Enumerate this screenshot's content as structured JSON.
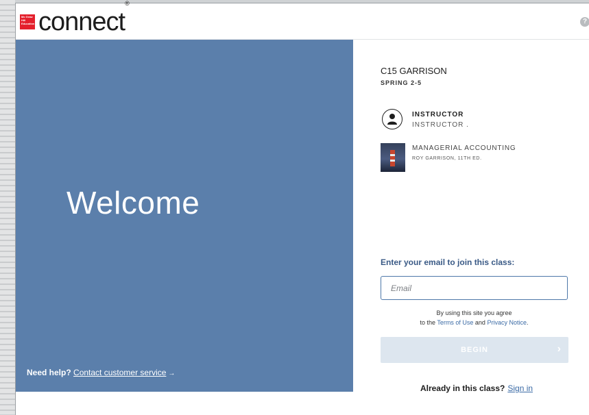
{
  "brand": {
    "publisher_logo_text": "Mc Graw Hill Education",
    "product_name": "connect",
    "trademark": "®",
    "accent_color": "#e4202c"
  },
  "header": {
    "help_icon": "?"
  },
  "left_panel": {
    "welcome": "Welcome",
    "help_prefix": "Need help?",
    "help_link": "Contact customer service",
    "help_arrow": "→",
    "background_color": "#5b7fab"
  },
  "course": {
    "title": "C15 GARRISON",
    "section": "SPRING 2-5"
  },
  "instructor": {
    "label": "INSTRUCTOR",
    "name": "INSTRUCTOR ."
  },
  "book": {
    "title": "MANAGERIAL ACCOUNTING",
    "author": "ROY GARRISON, 11TH ED."
  },
  "join": {
    "label": "Enter your email to join this class:",
    "email_placeholder": "Email",
    "email_value": ""
  },
  "legal": {
    "line1": "By using this site you agree",
    "prefix": "to the",
    "terms": "Terms of Use",
    "and": "and",
    "privacy": "Privacy Notice",
    "period": "."
  },
  "begin": {
    "label": "BEGIN",
    "chevron": "›"
  },
  "already": {
    "question": "Already in this class?",
    "sign_in": "Sign in"
  }
}
